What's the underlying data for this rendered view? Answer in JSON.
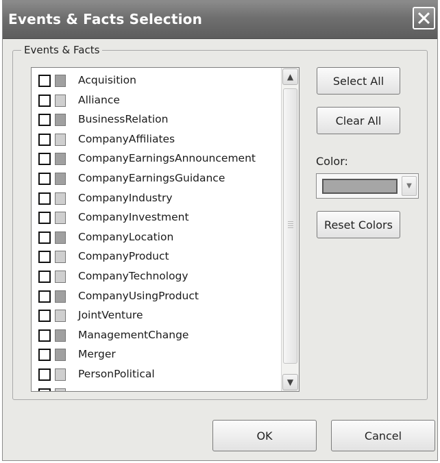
{
  "window": {
    "title": "Events & Facts Selection"
  },
  "group": {
    "label": "Events & Facts"
  },
  "list": {
    "items": [
      {
        "label": "Acquisition",
        "swatch": "#a0a0a0"
      },
      {
        "label": "Alliance",
        "swatch": "#cfcfcf"
      },
      {
        "label": "BusinessRelation",
        "swatch": "#a0a0a0"
      },
      {
        "label": "CompanyAffiliates",
        "swatch": "#cfcfcf"
      },
      {
        "label": "CompanyEarningsAnnouncement",
        "swatch": "#a0a0a0"
      },
      {
        "label": "CompanyEarningsGuidance",
        "swatch": "#a0a0a0"
      },
      {
        "label": "CompanyIndustry",
        "swatch": "#cfcfcf"
      },
      {
        "label": "CompanyInvestment",
        "swatch": "#cfcfcf"
      },
      {
        "label": "CompanyLocation",
        "swatch": "#a0a0a0"
      },
      {
        "label": "CompanyProduct",
        "swatch": "#cfcfcf"
      },
      {
        "label": "CompanyTechnology",
        "swatch": "#cfcfcf"
      },
      {
        "label": "CompanyUsingProduct",
        "swatch": "#a0a0a0"
      },
      {
        "label": "JointVenture",
        "swatch": "#cfcfcf"
      },
      {
        "label": "ManagementChange",
        "swatch": "#a0a0a0"
      },
      {
        "label": "Merger",
        "swatch": "#a0a0a0"
      },
      {
        "label": "PersonPolitical",
        "swatch": "#cfcfcf"
      },
      {
        "label": "",
        "swatch": "#cfcfcf"
      }
    ]
  },
  "buttons": {
    "select_all": "Select All",
    "clear_all": "Clear All",
    "reset_colors": "Reset Colors",
    "ok": "OK",
    "cancel": "Cancel"
  },
  "color": {
    "label": "Color:",
    "value": "#a6a6a6"
  },
  "icons": {
    "close": "close-icon",
    "scroll_up": "chevron-up-icon",
    "scroll_down": "chevron-down-icon",
    "dropdown": "dropdown-arrow-icon"
  }
}
